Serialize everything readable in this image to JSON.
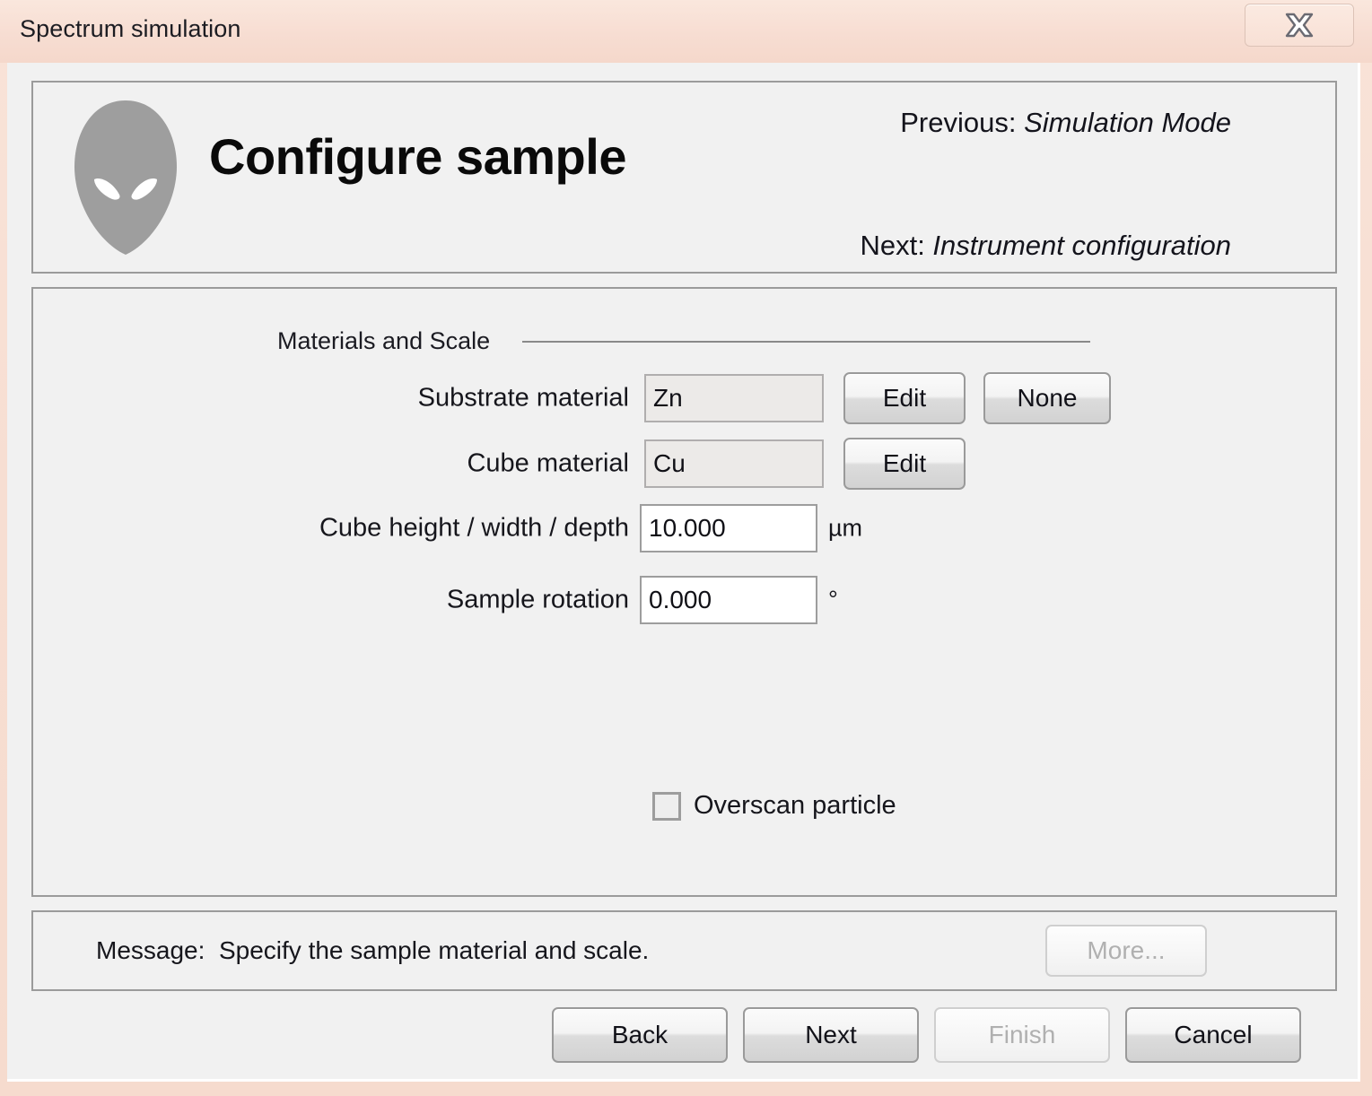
{
  "window": {
    "title": "Spectrum simulation",
    "close_icon": "close-x-icon"
  },
  "header": {
    "icon": "alien-head-icon",
    "page_title": "Configure sample",
    "previous_prefix": "Previous: ",
    "previous_step": "Simulation Mode",
    "next_prefix": "Next: ",
    "next_step": "Instrument configuration"
  },
  "content": {
    "group_label": "Materials and Scale",
    "rows": [
      {
        "label": "Substrate material",
        "value": "Zn",
        "field_kind": "readonly",
        "buttons": [
          "Edit",
          "None"
        ]
      },
      {
        "label": "Cube material",
        "value": "Cu",
        "field_kind": "readonly",
        "buttons": [
          "Edit"
        ]
      },
      {
        "label": "Cube height / width / depth",
        "value": "10.000",
        "field_kind": "editable",
        "unit": "µm"
      },
      {
        "label": "Sample rotation",
        "value": "0.000",
        "field_kind": "editable",
        "unit": "°"
      }
    ],
    "checkbox": {
      "label": "Overscan particle",
      "checked": false
    }
  },
  "message_bar": {
    "prefix": "Message:",
    "text": "Specify the sample material and scale.",
    "more_label": "More...",
    "more_enabled": false
  },
  "footer": {
    "buttons": [
      {
        "label": "Back",
        "enabled": true
      },
      {
        "label": "Next",
        "enabled": true
      },
      {
        "label": "Finish",
        "enabled": false
      },
      {
        "label": "Cancel",
        "enabled": true
      }
    ]
  },
  "colors": {
    "titlebar": "#f7ddd2",
    "client_background": "#f1f1f1",
    "panel_border": "#9b9b9b",
    "alien_gray": "#9e9e9e",
    "text": "#16161c",
    "disabled_text": "#b0b0b0"
  }
}
